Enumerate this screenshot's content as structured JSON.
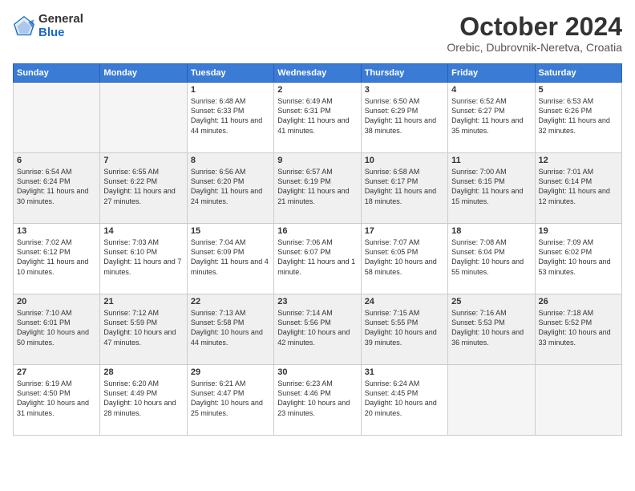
{
  "logo": {
    "general": "General",
    "blue": "Blue"
  },
  "title": "October 2024",
  "location": "Orebic, Dubrovnik-Neretva, Croatia",
  "days_of_week": [
    "Sunday",
    "Monday",
    "Tuesday",
    "Wednesday",
    "Thursday",
    "Friday",
    "Saturday"
  ],
  "weeks": [
    [
      {
        "day": "",
        "info": ""
      },
      {
        "day": "",
        "info": ""
      },
      {
        "day": "1",
        "info": "Sunrise: 6:48 AM\nSunset: 6:33 PM\nDaylight: 11 hours and 44 minutes."
      },
      {
        "day": "2",
        "info": "Sunrise: 6:49 AM\nSunset: 6:31 PM\nDaylight: 11 hours and 41 minutes."
      },
      {
        "day": "3",
        "info": "Sunrise: 6:50 AM\nSunset: 6:29 PM\nDaylight: 11 hours and 38 minutes."
      },
      {
        "day": "4",
        "info": "Sunrise: 6:52 AM\nSunset: 6:27 PM\nDaylight: 11 hours and 35 minutes."
      },
      {
        "day": "5",
        "info": "Sunrise: 6:53 AM\nSunset: 6:26 PM\nDaylight: 11 hours and 32 minutes."
      }
    ],
    [
      {
        "day": "6",
        "info": "Sunrise: 6:54 AM\nSunset: 6:24 PM\nDaylight: 11 hours and 30 minutes."
      },
      {
        "day": "7",
        "info": "Sunrise: 6:55 AM\nSunset: 6:22 PM\nDaylight: 11 hours and 27 minutes."
      },
      {
        "day": "8",
        "info": "Sunrise: 6:56 AM\nSunset: 6:20 PM\nDaylight: 11 hours and 24 minutes."
      },
      {
        "day": "9",
        "info": "Sunrise: 6:57 AM\nSunset: 6:19 PM\nDaylight: 11 hours and 21 minutes."
      },
      {
        "day": "10",
        "info": "Sunrise: 6:58 AM\nSunset: 6:17 PM\nDaylight: 11 hours and 18 minutes."
      },
      {
        "day": "11",
        "info": "Sunrise: 7:00 AM\nSunset: 6:15 PM\nDaylight: 11 hours and 15 minutes."
      },
      {
        "day": "12",
        "info": "Sunrise: 7:01 AM\nSunset: 6:14 PM\nDaylight: 11 hours and 12 minutes."
      }
    ],
    [
      {
        "day": "13",
        "info": "Sunrise: 7:02 AM\nSunset: 6:12 PM\nDaylight: 11 hours and 10 minutes."
      },
      {
        "day": "14",
        "info": "Sunrise: 7:03 AM\nSunset: 6:10 PM\nDaylight: 11 hours and 7 minutes."
      },
      {
        "day": "15",
        "info": "Sunrise: 7:04 AM\nSunset: 6:09 PM\nDaylight: 11 hours and 4 minutes."
      },
      {
        "day": "16",
        "info": "Sunrise: 7:06 AM\nSunset: 6:07 PM\nDaylight: 11 hours and 1 minute."
      },
      {
        "day": "17",
        "info": "Sunrise: 7:07 AM\nSunset: 6:05 PM\nDaylight: 10 hours and 58 minutes."
      },
      {
        "day": "18",
        "info": "Sunrise: 7:08 AM\nSunset: 6:04 PM\nDaylight: 10 hours and 55 minutes."
      },
      {
        "day": "19",
        "info": "Sunrise: 7:09 AM\nSunset: 6:02 PM\nDaylight: 10 hours and 53 minutes."
      }
    ],
    [
      {
        "day": "20",
        "info": "Sunrise: 7:10 AM\nSunset: 6:01 PM\nDaylight: 10 hours and 50 minutes."
      },
      {
        "day": "21",
        "info": "Sunrise: 7:12 AM\nSunset: 5:59 PM\nDaylight: 10 hours and 47 minutes."
      },
      {
        "day": "22",
        "info": "Sunrise: 7:13 AM\nSunset: 5:58 PM\nDaylight: 10 hours and 44 minutes."
      },
      {
        "day": "23",
        "info": "Sunrise: 7:14 AM\nSunset: 5:56 PM\nDaylight: 10 hours and 42 minutes."
      },
      {
        "day": "24",
        "info": "Sunrise: 7:15 AM\nSunset: 5:55 PM\nDaylight: 10 hours and 39 minutes."
      },
      {
        "day": "25",
        "info": "Sunrise: 7:16 AM\nSunset: 5:53 PM\nDaylight: 10 hours and 36 minutes."
      },
      {
        "day": "26",
        "info": "Sunrise: 7:18 AM\nSunset: 5:52 PM\nDaylight: 10 hours and 33 minutes."
      }
    ],
    [
      {
        "day": "27",
        "info": "Sunrise: 6:19 AM\nSunset: 4:50 PM\nDaylight: 10 hours and 31 minutes."
      },
      {
        "day": "28",
        "info": "Sunrise: 6:20 AM\nSunset: 4:49 PM\nDaylight: 10 hours and 28 minutes."
      },
      {
        "day": "29",
        "info": "Sunrise: 6:21 AM\nSunset: 4:47 PM\nDaylight: 10 hours and 25 minutes."
      },
      {
        "day": "30",
        "info": "Sunrise: 6:23 AM\nSunset: 4:46 PM\nDaylight: 10 hours and 23 minutes."
      },
      {
        "day": "31",
        "info": "Sunrise: 6:24 AM\nSunset: 4:45 PM\nDaylight: 10 hours and 20 minutes."
      },
      {
        "day": "",
        "info": ""
      },
      {
        "day": "",
        "info": ""
      }
    ]
  ]
}
